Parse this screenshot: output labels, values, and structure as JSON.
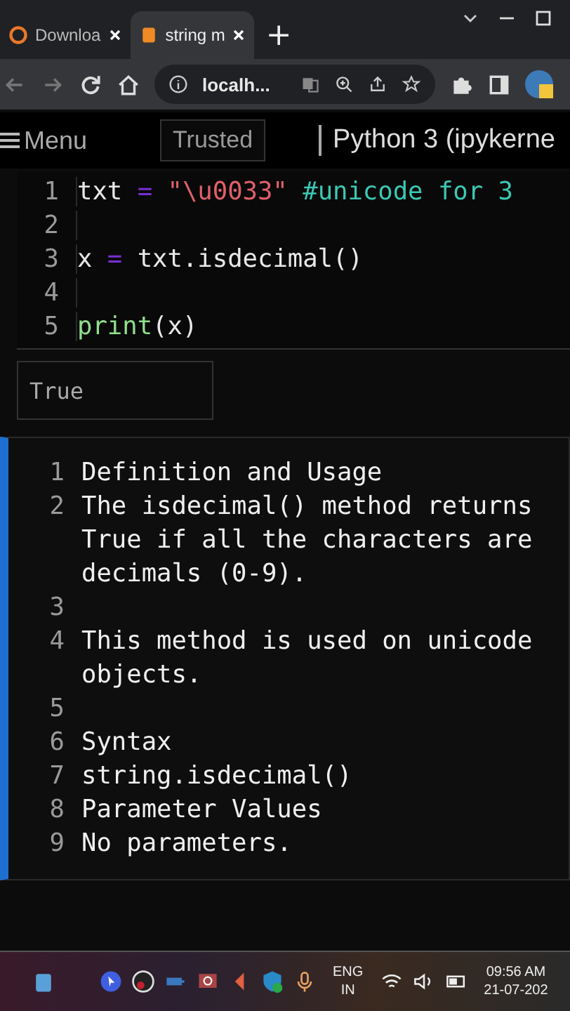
{
  "browser": {
    "tabs": [
      {
        "title": "Downloa",
        "selected": false
      },
      {
        "title": "string m",
        "selected": true
      }
    ],
    "new_tab": "+",
    "address": "localh..."
  },
  "notebook": {
    "menu": "Menu",
    "trusted": "Trusted",
    "kernel": "Python 3 (ipykerne"
  },
  "code_cell": {
    "lines": [
      {
        "number": "1",
        "tokens": [
          {
            "kind": "name",
            "text": "txt"
          },
          {
            "kind": "op",
            "text": " = "
          },
          {
            "kind": "string",
            "text": "\"\\u0033\""
          },
          {
            "kind": "comment",
            "text": " #unicode for 3"
          }
        ]
      },
      {
        "number": "2"
      },
      {
        "number": "3",
        "tokens": [
          {
            "kind": "name",
            "text": "x"
          },
          {
            "kind": "op",
            "text": " = "
          },
          {
            "kind": "name",
            "text": "txt.isdecimal()"
          }
        ]
      },
      {
        "number": "4"
      },
      {
        "number": "5",
        "tokens": [
          {
            "kind": "builtin",
            "text": "print"
          },
          {
            "kind": "name",
            "text": "(x)"
          }
        ]
      }
    ],
    "output": "True"
  },
  "markdown_cell": {
    "selected": true,
    "lines": [
      {
        "number": "1",
        "text": "Definition and Usage"
      },
      {
        "number": "2",
        "text": "The isdecimal() method returns"
      },
      {
        "text": "True if all the characters are"
      },
      {
        "text": "decimals (0-9)."
      },
      {
        "number": "3"
      },
      {
        "number": "4",
        "text": "This method is used on unicode"
      },
      {
        "text": "objects."
      },
      {
        "number": "5"
      },
      {
        "number": "6",
        "text": "Syntax"
      },
      {
        "number": "7",
        "text": "string.isdecimal()"
      },
      {
        "number": "8",
        "text": "Parameter Values"
      },
      {
        "number": "9",
        "text": "No parameters."
      }
    ]
  },
  "taskbar": {
    "language": "ENG",
    "region": "IN",
    "time": "09:56 AM",
    "date": "21-07-202"
  }
}
